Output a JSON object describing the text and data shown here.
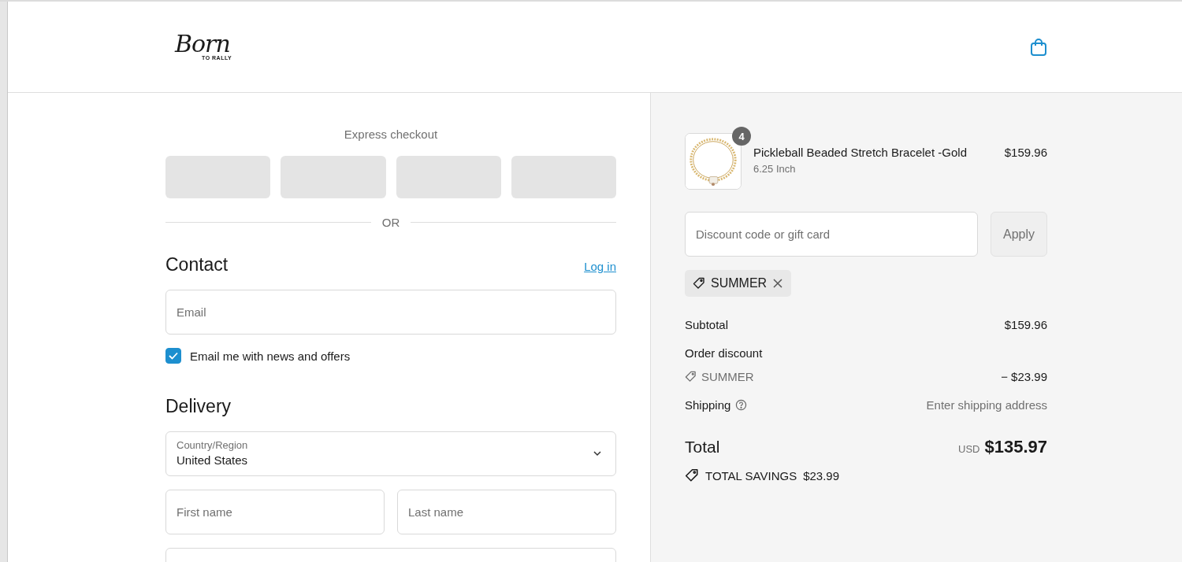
{
  "header": {
    "logo": {
      "main": "Born",
      "sub": "TO RALLY"
    }
  },
  "express_checkout": {
    "title": "Express checkout",
    "buttons": [
      {
        "kind": "wallet"
      },
      {
        "kind": "wallet"
      },
      {
        "kind": "wallet"
      },
      {
        "kind": "wallet"
      }
    ],
    "divider": "OR"
  },
  "contact": {
    "heading": "Contact",
    "login_link": "Log in",
    "email": {
      "placeholder": "Email"
    },
    "marketing_opt_in": {
      "label": "Email me with news and offers",
      "checked": true
    }
  },
  "delivery": {
    "heading": "Delivery",
    "country": {
      "label": "Country/Region",
      "value": "United States"
    },
    "fields": [
      {
        "placeholder": "First name"
      },
      {
        "placeholder": "Last name"
      }
    ],
    "more_fields": [
      {
        "kind": "blank"
      }
    ]
  },
  "order_summary": {
    "items": [
      {
        "kind": "picture",
        "quantity": "4",
        "name": "Pickleball Beaded Stretch Bracelet -Gold",
        "variant": "6.25 Inch",
        "price": "$159.96"
      }
    ],
    "discount": {
      "placeholder": "Discount code or gift card",
      "button": "Apply"
    },
    "applied_codes": [
      {
        "code": "SUMMER"
      }
    ],
    "lines": [
      {
        "kind": "plain",
        "label": "Subtotal",
        "value": "$159.96"
      },
      {
        "kind": "heading",
        "label": "Order discount"
      },
      {
        "kind": "code",
        "label": "SUMMER",
        "value": "− $23.99"
      },
      {
        "kind": "info",
        "label": "Shipping",
        "value": "Enter shipping address"
      }
    ],
    "total": {
      "label": "Total",
      "currency": "USD",
      "value": "$135.97"
    },
    "savings": {
      "label": "TOTAL SAVINGS",
      "value": "$23.99"
    }
  }
}
